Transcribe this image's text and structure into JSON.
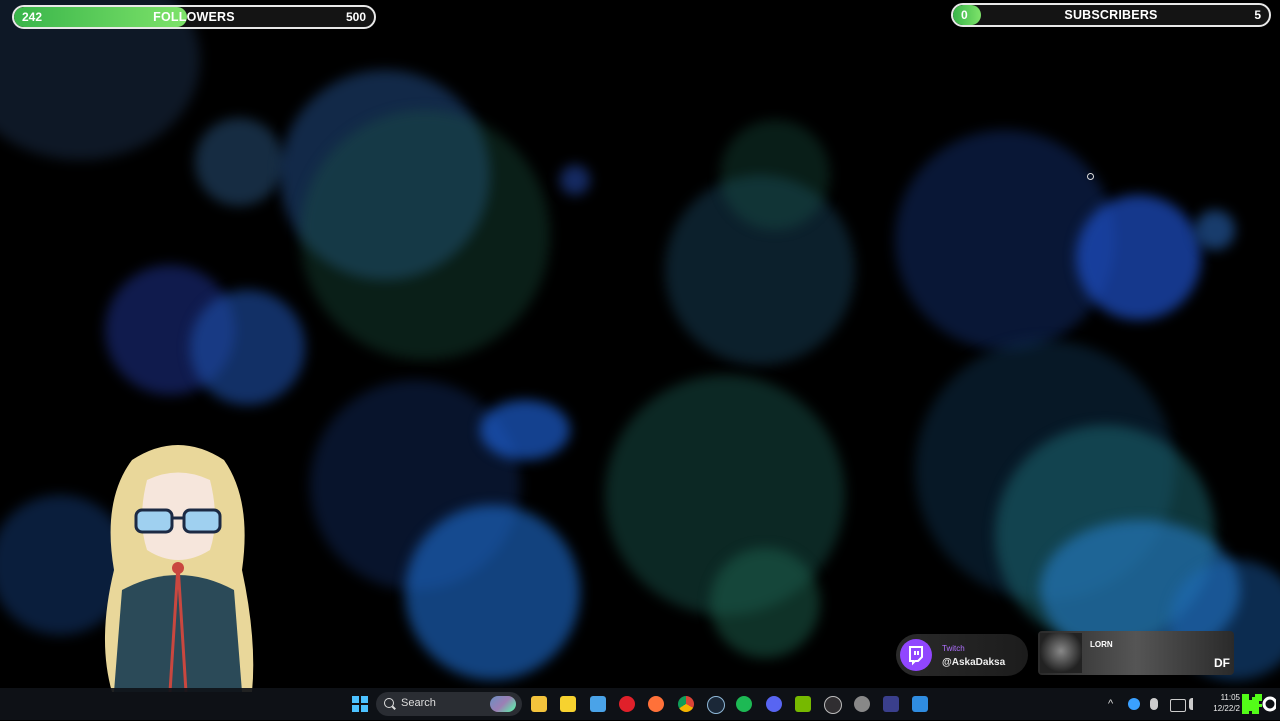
{
  "followers_goal": {
    "current": "242",
    "label": "FOLLOWERS",
    "target": "500",
    "progress": 0.48
  },
  "subscribers_goal": {
    "current": "0",
    "label": "SUBSCRIBERS",
    "target": "5",
    "progress": 0.0
  },
  "twitch_badge": {
    "platform": "Twitch",
    "handle": "@AskaDaksa",
    "icon": "twitch-icon"
  },
  "now_playing": {
    "artist": "LORN",
    "song": "DF"
  },
  "taskbar": {
    "search_label": "Search",
    "apps": [
      "windows-start-icon",
      "search-icon",
      "file-explorer-icon",
      "sticky-notes-icon",
      "notepad-icon",
      "opera-icon",
      "firefox-icon",
      "chrome-icon",
      "steam-icon",
      "spotify-icon",
      "discord-icon",
      "nvidia-icon",
      "obs-icon",
      "settings-icon",
      "vs-code-icon",
      "photos-icon"
    ],
    "tray_up": "^",
    "clock_time": "11:05",
    "clock_date": "12/22/2"
  },
  "colors": {
    "goal_fill": "#39b54a",
    "twitch": "#9146ff",
    "spotify": "#1db954"
  }
}
